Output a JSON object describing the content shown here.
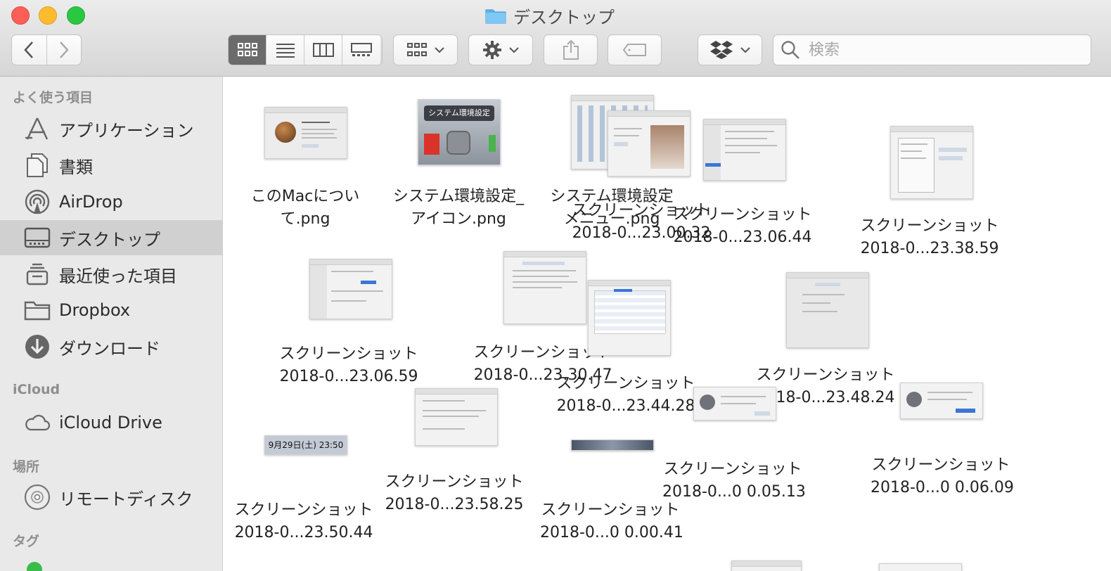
{
  "window": {
    "title": "デスクトップ"
  },
  "toolbar": {
    "search_placeholder": "検索",
    "view_modes": [
      "icon",
      "list",
      "column",
      "gallery"
    ],
    "active_view": "icon"
  },
  "sidebar": {
    "sections": [
      {
        "title": "よく使う項目",
        "items": [
          {
            "label": "アプリケーション",
            "icon": "applications-icon"
          },
          {
            "label": "書類",
            "icon": "documents-icon"
          },
          {
            "label": "AirDrop",
            "icon": "airdrop-icon"
          },
          {
            "label": "デスクトップ",
            "icon": "desktop-icon",
            "selected": true
          },
          {
            "label": "最近使った項目",
            "icon": "recents-icon"
          },
          {
            "label": "Dropbox",
            "icon": "folder-icon"
          },
          {
            "label": "ダウンロード",
            "icon": "downloads-icon"
          }
        ]
      },
      {
        "title": "iCloud",
        "items": [
          {
            "label": "iCloud Drive",
            "icon": "cloud-icon"
          }
        ]
      },
      {
        "title": "場所",
        "items": [
          {
            "label": "リモートディスク",
            "icon": "disc-icon"
          }
        ]
      },
      {
        "title": "タグ",
        "items": []
      }
    ]
  },
  "files": [
    {
      "line1": "このMacについ",
      "line2": "て.png"
    },
    {
      "line1": "システム環境設定_",
      "line2": "アイコン.png",
      "thumb_text": "システム環境設定"
    },
    {
      "line1": "システム環境設定",
      "line2": "メニュー.png"
    },
    {
      "line1": "スクリーンショット",
      "line2": "2018-0...23.00.32"
    },
    {
      "line1": "スクリーンショット",
      "line2": "2018-0...23.06.44"
    },
    {
      "line1": "スクリーンショット",
      "line2": "2018-0...23.38.59"
    },
    {
      "line1": "スクリーンショット",
      "line2": "2018-0...23.06.59"
    },
    {
      "line1": "スクリーンショット",
      "line2": "2018-0...23.30.47"
    },
    {
      "line1": "スクリーンショット",
      "line2": "2018-0...23.44.28"
    },
    {
      "line1": "スクリーンショット",
      "line2": "2018-0...23.48.24"
    },
    {
      "line1": "スクリーンショット",
      "line2": "2018-0...23.50.44",
      "thumb_text": "9月29日(土)  23:50"
    },
    {
      "line1": "スクリーンショット",
      "line2": "2018-0...23.58.25"
    },
    {
      "line1": "スクリーンショット",
      "line2": "2018-0...0 0.00.41"
    },
    {
      "line1": "スクリーンショット",
      "line2": "2018-0...0 0.05.13"
    },
    {
      "line1": "スクリーンショット",
      "line2": "2018-0...0 0.06.09"
    }
  ]
}
